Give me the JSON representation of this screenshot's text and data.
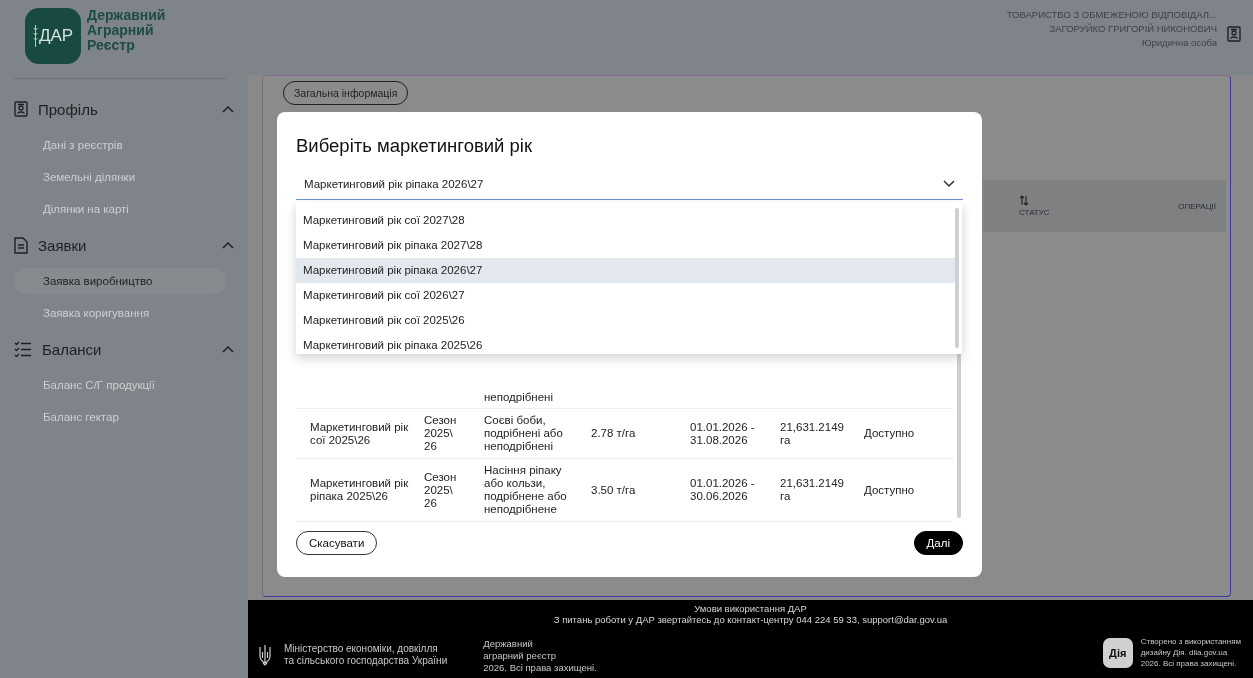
{
  "header": {
    "logo": {
      "mark": "ДАР",
      "lines": [
        "Державний",
        "Аграрний",
        "Реєстр"
      ]
    },
    "user": {
      "company": "ТОВАРИСТВО З ОБМЕЖЕНОЮ ВІДПОВІДАЛ...",
      "name": "ЗАГОРУЙКО ГРИГОРІЙ НИКОНОВИЧ",
      "role": "Юридична особа"
    }
  },
  "sidebar": {
    "sections": [
      {
        "title": "Профіль",
        "expanded": true,
        "items": [
          {
            "label": "Дані з реєстрів",
            "selected": false
          },
          {
            "label": "Земельні ділянки",
            "selected": false
          },
          {
            "label": "Ділянки на карті",
            "selected": false
          }
        ]
      },
      {
        "title": "Заявки",
        "expanded": true,
        "items": [
          {
            "label": "Заявка виробництво",
            "selected": true
          },
          {
            "label": "Заявка коригування",
            "selected": false
          }
        ]
      },
      {
        "title": "Баланси",
        "expanded": true,
        "items": [
          {
            "label": "Баланс С/Г продукції",
            "selected": false
          },
          {
            "label": "Баланс гектар",
            "selected": false
          }
        ]
      }
    ]
  },
  "main": {
    "tab_label": "Загальна інформація",
    "table_header": [
      {
        "label": "СТАТУС",
        "sortable": true
      },
      {
        "label": "ОПЕРАЦІЇ",
        "sortable": false
      }
    ]
  },
  "modal": {
    "title": "Виберіть маркетинговий рік",
    "select": {
      "value": "Маркетинговий рік ріпака 2026\\27",
      "expanded": true
    },
    "options": [
      {
        "label": "Маркетинговий рік сої 2027\\28",
        "selected": false
      },
      {
        "label": "Маркетинговий рік ріпака 2027\\28",
        "selected": false
      },
      {
        "label": "Маркетинговий рік ріпака 2026\\27",
        "selected": true
      },
      {
        "label": "Маркетинговий рік сої 2026\\27",
        "selected": false
      },
      {
        "label": "Маркетинговий рік сої 2025\\26",
        "selected": false
      },
      {
        "label": "Маркетинговий рік ріпака 2025\\26",
        "selected": false
      }
    ],
    "table": {
      "rows": [
        {
          "column_3": "неподрібнені"
        },
        {
          "column_1": "Маркетинговий рік сої 2025\\26",
          "column_2": "Сезон 2025\\ 26",
          "column_3": "Соєві боби, подрібнені або неподрібнені",
          "column_4": "2.78 т/га",
          "column_5": "01.01.2026 - 31.08.2026",
          "column_6": "21,631.2149 га",
          "column_7": "Доступно"
        },
        {
          "column_1": "Маркетинговий рік ріпака 2025\\26",
          "column_2": "Сезон 2025\\ 26",
          "column_3": "Насіння ріпаку або кользи, подрібнене або неподрібнене",
          "column_4": "3.50 т/га",
          "column_5": "01.01.2026 - 30.06.2026",
          "column_6": "21,631.2149 га",
          "column_7": "Доступно"
        }
      ]
    },
    "buttons": [
      {
        "label": "Скасувати",
        "kind": "secondary"
      },
      {
        "label": "Далі",
        "kind": "primary"
      }
    ]
  },
  "footer": {
    "terms": "Умови використання ДАР",
    "contact": "З питань роботи у ДАР звертайтесь до контакт-центру 044 224 59 33, support@dar.gov.ua",
    "ministry": [
      "Міністерство економіки, довкілля",
      "та сільського господарства України"
    ],
    "registry": [
      "Державний",
      "аграрний реєстр",
      "2026. Всі права захищені."
    ],
    "diia_badge": "Дія",
    "diia_text": [
      "Створено з використанням",
      "дизайну Дія. diia.gov.ua",
      "2026. Всі права захищені."
    ]
  }
}
